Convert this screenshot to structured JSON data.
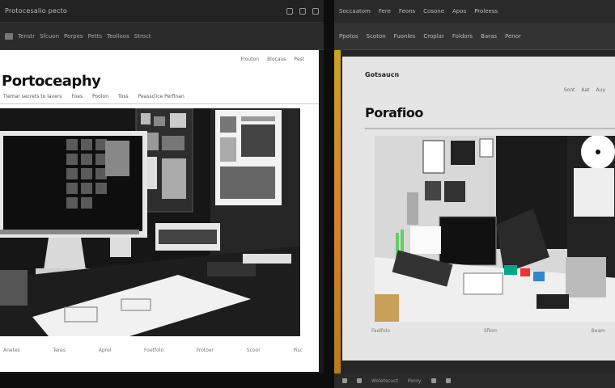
{
  "left_window": {
    "title": "Protocesalio pecto",
    "toolbar": [
      "Tenstr",
      "Sfcuon",
      "Porpes",
      "Petts",
      "Teolloos",
      "Stroct"
    ],
    "page": {
      "nav": [
        "Frouton",
        "Blocaus",
        "Pest"
      ],
      "heading": "Portoceaphy",
      "subline": [
        "Tiemar secrets to lavers",
        "Foes",
        "Poolon",
        "Toss",
        "Peassclice Perfinan"
      ],
      "footer": [
        "Anetes",
        "Teres",
        "Aprel",
        "Foetfolo",
        "Frotoer",
        "Scoor",
        "Pisc"
      ]
    }
  },
  "right_window": {
    "titlebar": [
      "Soccaatom",
      "Fere",
      "Feons",
      "Cosone",
      "Apos",
      "Proleess"
    ],
    "tabs": [
      "Ppotos",
      "Scoton",
      "Fuonles",
      "Croplar",
      "Foldors",
      "Baras",
      "Penor"
    ],
    "page": {
      "label": "Gotsaucn",
      "mini_nav": [
        "Sont",
        "Aat",
        "Auy"
      ],
      "heading": "Porafioo",
      "footer": [
        "Faelfolo",
        "Sflom",
        "Beam"
      ]
    },
    "taskbar": [
      "Woletscuct",
      "Peroy"
    ]
  },
  "colors": {
    "accent_strip": "#d9822b",
    "window_bg": "#262626",
    "page_bg": "#ffffff"
  }
}
